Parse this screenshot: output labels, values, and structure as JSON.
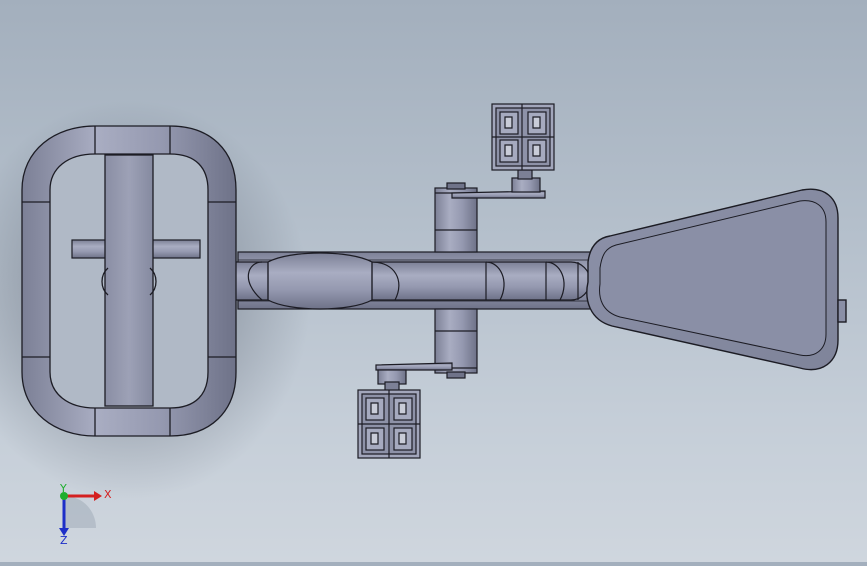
{
  "viewport": {
    "background_top": "#a3afbd",
    "background_bottom": "#cfd6de",
    "model_color": "#8d92a8",
    "edge_color": "#1c1c24"
  },
  "triad": {
    "x_label": "X",
    "y_label": "Y",
    "z_label": "Z",
    "x_color": "#d42020",
    "y_color": "#1fae2e",
    "z_color": "#1d2ec8"
  }
}
